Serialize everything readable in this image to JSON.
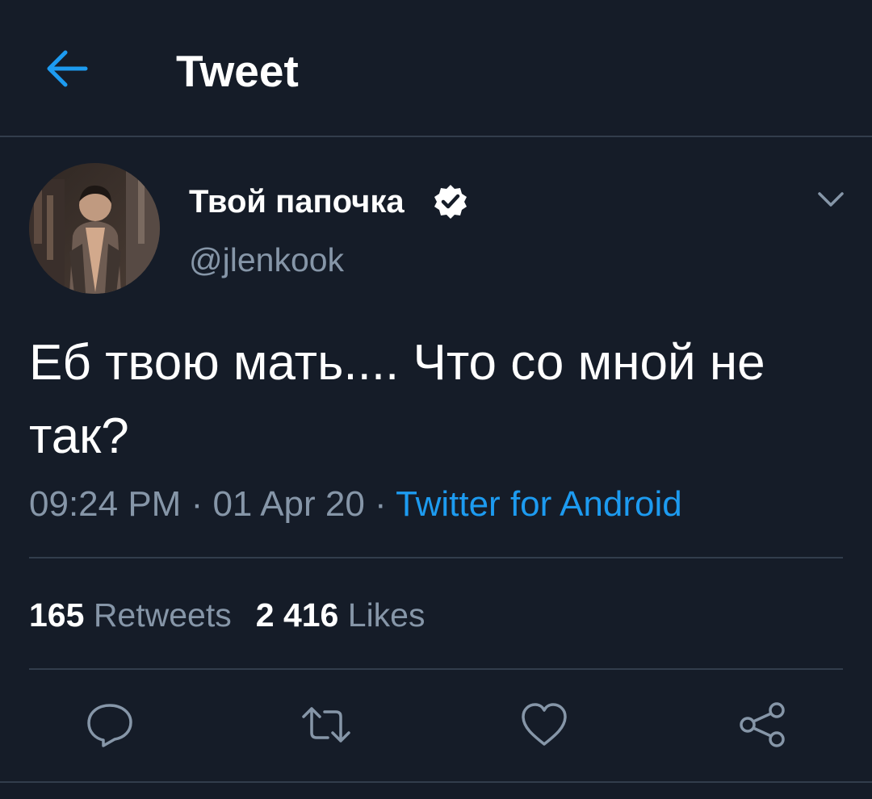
{
  "header": {
    "title": "Tweet",
    "back_icon": "arrow-left-icon"
  },
  "tweet": {
    "author": {
      "display_name": "Твой папочка",
      "handle": "@jlenkook",
      "verified": true
    },
    "text": "Еб твою мать.... Что со мной не так?",
    "meta": {
      "time": "09:24 PM",
      "separator": " · ",
      "date": "01 Apr 20",
      "source": "Twitter for Android"
    },
    "stats": {
      "retweets_count": "165",
      "retweets_label": "Retweets",
      "likes_count": "2 416",
      "likes_label": "Likes"
    },
    "actions": [
      "reply-icon",
      "retweet-icon",
      "like-icon",
      "share-icon"
    ]
  },
  "colors": {
    "background": "#151c28",
    "accent": "#1d9bf0",
    "secondary_text": "#8696a8",
    "divider": "#323d4c"
  }
}
